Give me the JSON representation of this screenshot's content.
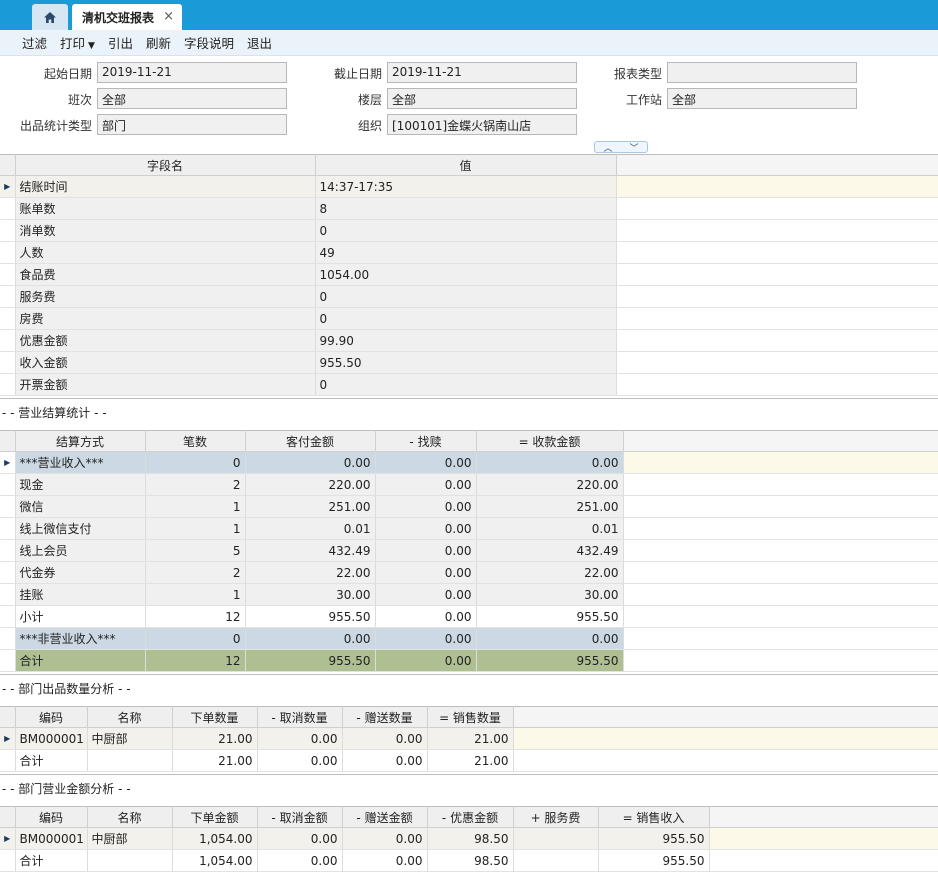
{
  "tabs": {
    "home_icon": "home-icon",
    "active": "清机交班报表",
    "close": "×"
  },
  "toolbar": [
    "过滤",
    "打印",
    "引出",
    "刷新",
    "字段说明",
    "退出"
  ],
  "form": {
    "start_date_label": "起始日期",
    "start_date": "2019-11-21",
    "end_date_label": "截止日期",
    "end_date": "2019-11-21",
    "report_type_label": "报表类型",
    "report_type": "",
    "shift_label": "班次",
    "shift": "全部",
    "floor_label": "楼层",
    "floor": "全部",
    "station_label": "工作站",
    "station": "全部",
    "stat_type_label": "出品统计类型",
    "stat_type": "部门",
    "org_label": "组织",
    "org": "[100101]金蝶火锅南山店"
  },
  "grid1": {
    "headers": [
      "字段名",
      "值"
    ],
    "rows": [
      [
        "结账时间",
        "14:37-17:35"
      ],
      [
        "账单数",
        "8"
      ],
      [
        "消单数",
        "0"
      ],
      [
        "人数",
        "49"
      ],
      [
        "食品费",
        "1054.00"
      ],
      [
        "服务费",
        "0"
      ],
      [
        "房费",
        "0"
      ],
      [
        "优惠金额",
        "99.90"
      ],
      [
        "收入金额",
        "955.50"
      ],
      [
        "开票金额",
        "0"
      ]
    ]
  },
  "section2_title": "- - 营业结算统计 - -",
  "grid2": {
    "headers": [
      "结算方式",
      "笔数",
      "客付金额",
      "- 找赎",
      "= 收款金额"
    ],
    "rows": [
      [
        "***营业收入***",
        "0",
        "0.00",
        "0.00",
        "0.00"
      ],
      [
        "现金",
        "2",
        "220.00",
        "0.00",
        "220.00"
      ],
      [
        "微信",
        "1",
        "251.00",
        "0.00",
        "251.00"
      ],
      [
        "线上微信支付",
        "1",
        "0.01",
        "0.00",
        "0.01"
      ],
      [
        "线上会员",
        "5",
        "432.49",
        "0.00",
        "432.49"
      ],
      [
        "代金券",
        "2",
        "22.00",
        "0.00",
        "22.00"
      ],
      [
        "挂账",
        "1",
        "30.00",
        "0.00",
        "30.00"
      ],
      [
        "小计",
        "12",
        "955.50",
        "0.00",
        "955.50"
      ],
      [
        "***非营业收入***",
        "0",
        "0.00",
        "0.00",
        "0.00"
      ],
      [
        "合计",
        "12",
        "955.50",
        "0.00",
        "955.50"
      ]
    ]
  },
  "section3_title": "- - 部门出品数量分析 - -",
  "grid3": {
    "headers": [
      "编码",
      "名称",
      "下单数量",
      "- 取消数量",
      "- 赠送数量",
      "= 销售数量"
    ],
    "rows": [
      [
        "BM000001",
        "中厨部",
        "21.00",
        "0.00",
        "0.00",
        "21.00"
      ],
      [
        "合计",
        "",
        "21.00",
        "0.00",
        "0.00",
        "21.00"
      ]
    ]
  },
  "section4_title": "- - 部门营业金额分析 - -",
  "grid4": {
    "headers": [
      "编码",
      "名称",
      "下单金额",
      "- 取消金额",
      "- 赠送金额",
      "- 优惠金额",
      "+ 服务费",
      "= 销售收入"
    ],
    "rows": [
      [
        "BM000001",
        "中厨部",
        "1,054.00",
        "0.00",
        "0.00",
        "98.50",
        "",
        "955.50"
      ],
      [
        "合计",
        "",
        "1,054.00",
        "0.00",
        "0.00",
        "98.50",
        "",
        "955.50"
      ]
    ]
  },
  "colors": {
    "tabbar": "#1a9ad6",
    "toolbar": "#eaf2fa",
    "row_blue": "#ccd8e3",
    "row_green": "#aebf91",
    "selected_fill": "#fdf9e8"
  }
}
